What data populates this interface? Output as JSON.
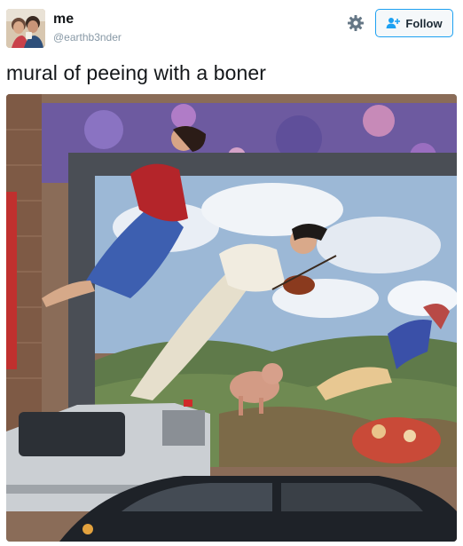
{
  "user": {
    "name": "me",
    "handle": "@earthb3nder"
  },
  "actions": {
    "follow_label": "Follow",
    "settings_icon": "gear-icon",
    "follow_icon": "add-user-icon"
  },
  "tweet": {
    "text": "mural of peeing with a boner"
  },
  "colors": {
    "accent": "#1da1f2",
    "handle_gray": "#8899a6",
    "text": "#14171a"
  }
}
